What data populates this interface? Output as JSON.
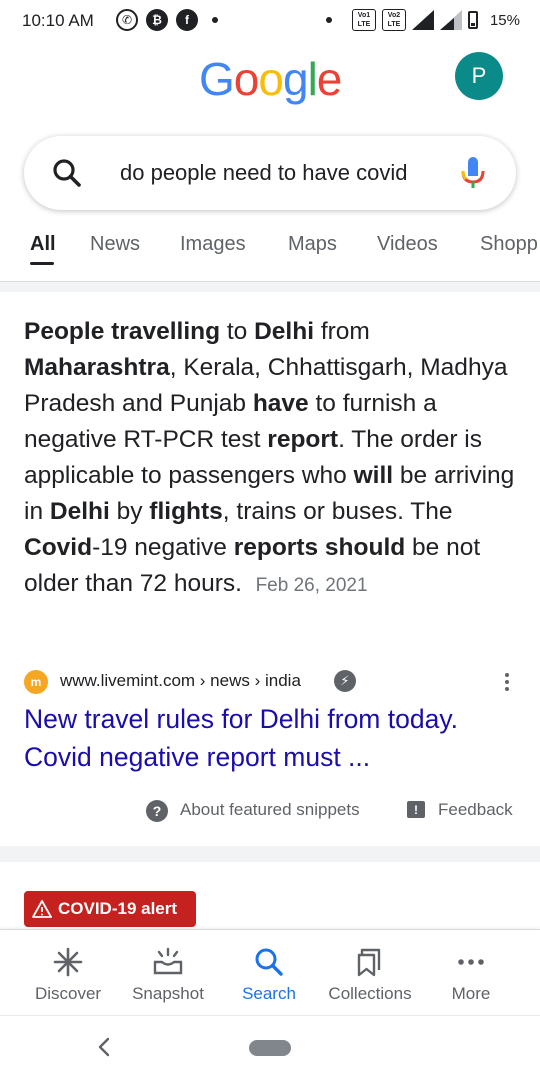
{
  "status_bar": {
    "time": "10:10 AM",
    "battery": "15%",
    "volte_1": "Vo1 LTE",
    "volte_2": "Vo2 LTE"
  },
  "header": {
    "logo_letters": [
      "G",
      "o",
      "o",
      "g",
      "l",
      "e"
    ],
    "avatar_initial": "P"
  },
  "search": {
    "query": "do people need to have covid"
  },
  "tabs": [
    {
      "label": "All"
    },
    {
      "label": "News"
    },
    {
      "label": "Images"
    },
    {
      "label": "Maps"
    },
    {
      "label": "Videos"
    },
    {
      "label": "Shopp"
    }
  ],
  "snippet": {
    "t1": "People travelling",
    "t2": " to ",
    "t3": "Delhi",
    "t4": " from ",
    "t5": "Maharashtra",
    "t6": ", Kerala, Chhattisgarh, Madhya Pradesh and Punjab ",
    "t7": "have",
    "t8": " to furnish a negative RT-PCR test ",
    "t9": "report",
    "t10": ". The order is applicable to passengers who ",
    "t11": "will",
    "t12": " be arriving in ",
    "t13": "Delhi",
    "t14": " by ",
    "t15": "flights",
    "t16": ", trains or buses. The ",
    "t17": "Covid",
    "t18": "-19 negative ",
    "t19": "reports should",
    "t20": " be not older than 72 hours.",
    "date": "Feb 26, 2021"
  },
  "source": {
    "favicon_letter": "m",
    "url": "www.livemint.com › news › india"
  },
  "result": {
    "title": "New travel rules for Delhi from today. Covid negative report must ..."
  },
  "snippet_footer": {
    "about": "About featured snippets",
    "feedback": "Feedback"
  },
  "covid_alert": {
    "label": "COVID-19 alert"
  },
  "bottom_nav": [
    {
      "label": "Discover"
    },
    {
      "label": "Snapshot"
    },
    {
      "label": "Search"
    },
    {
      "label": "Collections"
    },
    {
      "label": "More"
    }
  ],
  "colors": {
    "link": "#1a0dab",
    "accent": "#1a73e8",
    "alert": "#c5221f",
    "avatar": "#0b8a8a"
  }
}
